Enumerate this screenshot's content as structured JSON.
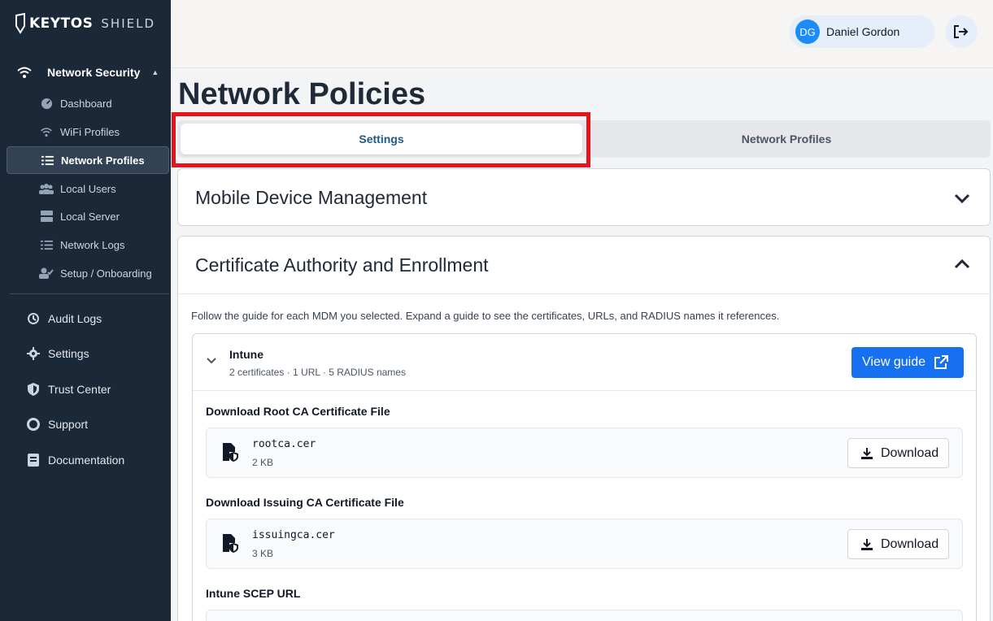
{
  "brand": {
    "name": "KEYTOS",
    "product": "SHIELD"
  },
  "sidebar": {
    "group": {
      "label": "Network Security",
      "icon": "wifi-icon"
    },
    "sub_items": [
      {
        "label": "Dashboard",
        "icon": "dashboard-icon"
      },
      {
        "label": "WiFi Profiles",
        "icon": "wifi-icon"
      },
      {
        "label": "Network Profiles",
        "icon": "list-icon",
        "active": true
      },
      {
        "label": "Local Users",
        "icon": "users-icon"
      },
      {
        "label": "Local Server",
        "icon": "server-icon"
      },
      {
        "label": "Network Logs",
        "icon": "list-icon"
      },
      {
        "label": "Setup / Onboarding",
        "icon": "user-check-icon"
      }
    ],
    "main_items": [
      {
        "label": "Audit Logs",
        "icon": "history-icon"
      },
      {
        "label": "Settings",
        "icon": "gear-icon"
      },
      {
        "label": "Trust Center",
        "icon": "shield-icon"
      },
      {
        "label": "Support",
        "icon": "lifebuoy-icon"
      },
      {
        "label": "Documentation",
        "icon": "book-icon"
      }
    ]
  },
  "user": {
    "initials": "DG",
    "name": "Daniel Gordon"
  },
  "page": {
    "title": "Network Policies"
  },
  "tabs": [
    {
      "label": "Settings",
      "selected": true
    },
    {
      "label": "Network Profiles",
      "selected": false
    }
  ],
  "sections": {
    "mdm": {
      "title": "Mobile Device Management",
      "expanded": false
    },
    "ca": {
      "title": "Certificate Authority and Enrollment",
      "expanded": true,
      "help": "Follow the guide for each MDM you selected. Expand a guide to see the certificates, URLs, and RADIUS names it references."
    }
  },
  "intune": {
    "title": "Intune",
    "summary": "2 certificates · 1 URL · 5 RADIUS names",
    "guide_button": "View guide",
    "root_title": "Download Root CA Certificate File",
    "root_file": {
      "name": "rootca.cer",
      "size": "2 KB"
    },
    "issuing_title": "Download Issuing CA Certificate File",
    "issuing_file": {
      "name": "issuingca.cer",
      "size": "3 KB"
    },
    "download_label": "Download",
    "scep_title": "Intune SCEP URL"
  },
  "colors": {
    "sidebar": "#1b2838",
    "accent": "#1670f0",
    "highlight": "#e3141c",
    "tab_active_text": "#1e5a8a"
  }
}
